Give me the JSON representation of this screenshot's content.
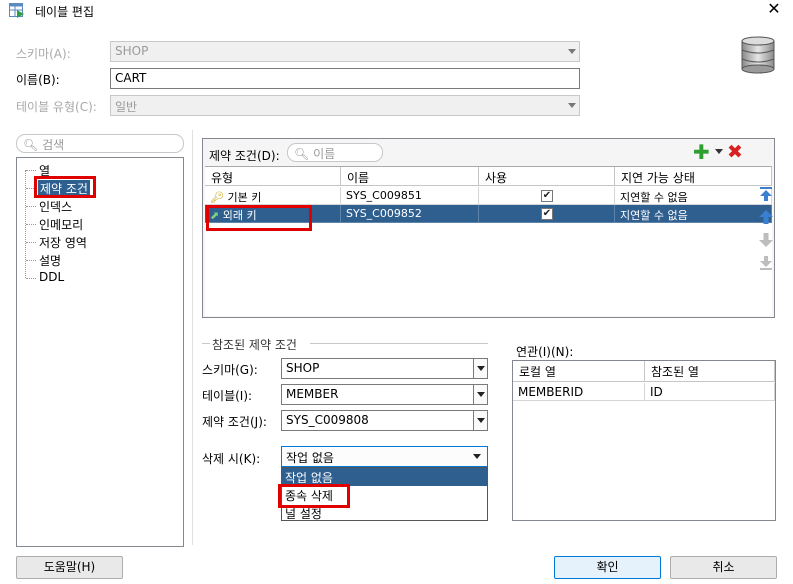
{
  "window": {
    "title": "테이블 편집"
  },
  "form": {
    "schema_label": "스키마(A):",
    "schema_value": "SHOP",
    "name_label": "이름(B):",
    "name_value": "CART",
    "table_type_label": "테이블 유형(C):",
    "table_type_value": "일반"
  },
  "sidebar": {
    "search_placeholder": "검색",
    "items": [
      {
        "label": "열"
      },
      {
        "label": "제약 조건"
      },
      {
        "label": "인덱스"
      },
      {
        "label": "인메모리"
      },
      {
        "label": "저장 영역"
      },
      {
        "label": "설명"
      },
      {
        "label": "DDL"
      }
    ]
  },
  "constraints": {
    "label": "제약 조건(D):",
    "search_placeholder": "이름",
    "columns": [
      "유형",
      "이름",
      "사용",
      "지연 가능 상태"
    ],
    "rows": [
      {
        "type": "기본 키",
        "name": "SYS_C009851",
        "enabled": true,
        "deferrable": "지연할 수 없음"
      },
      {
        "type": "외래 키",
        "name": "SYS_C009852",
        "enabled": true,
        "deferrable": "지연할 수 없음"
      }
    ],
    "selected_row": 1
  },
  "referenced": {
    "section_title": "참조된 제약 조건",
    "schema_label": "스키마(G):",
    "schema_value": "SHOP",
    "table_label": "테이블(I):",
    "table_value": "MEMBER",
    "constraint_label": "제약 조건(J):",
    "constraint_value": "SYS_C009808",
    "on_delete_label": "삭제 시(K):",
    "on_delete_value": "작업 없음",
    "on_delete_options": [
      "작업 없음",
      "종속 삭제",
      "널 설정"
    ]
  },
  "relation": {
    "label": "연관(I)(N):",
    "columns": [
      "로컬 열",
      "참조된 열"
    ],
    "rows": [
      {
        "local": "MEMBERID",
        "referenced": "ID"
      }
    ]
  },
  "buttons": {
    "help": "도움말(H)",
    "ok": "확인",
    "cancel": "취소"
  },
  "colors": {
    "selection": "#2f5f8f",
    "highlight": "#e00000",
    "add": "#2e9e2e",
    "remove": "#d92020"
  }
}
